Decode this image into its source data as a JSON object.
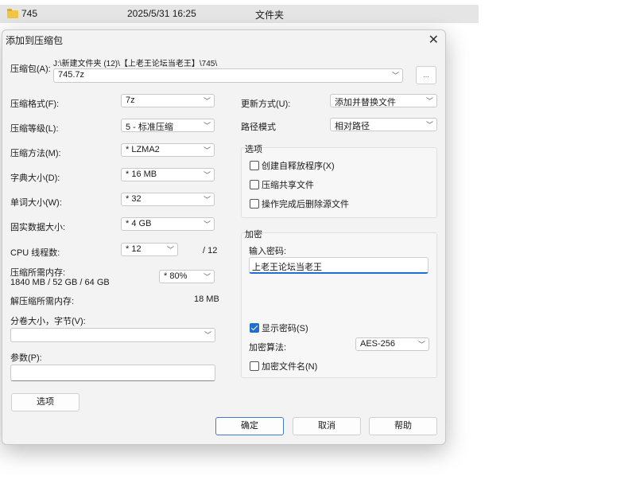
{
  "file_row": {
    "name": "745",
    "date": "2025/5/31 16:25",
    "type": "文件夹"
  },
  "dialog": {
    "title": "添加到压缩包",
    "archive_label": "压缩包(A):",
    "archive_path": "J:\\新建文件夹 (12)\\【上老王论坛当老王】\\745\\",
    "archive_name": "745.7z",
    "browse_label": "...",
    "format_label": "压缩格式(F):",
    "format_value": "7z",
    "level_label": "压缩等级(L):",
    "level_value": "5 - 标准压缩",
    "method_label": "压缩方法(M):",
    "method_value": "* LZMA2",
    "dict_label": "字典大小(D):",
    "dict_value": "* 16 MB",
    "word_label": "单词大小(W):",
    "word_value": "* 32",
    "solid_label": "固实数据大小:",
    "solid_value": "* 4 GB",
    "cpu_label": "CPU 线程数:",
    "cpu_value": "* 12",
    "cpu_max": "/ 12",
    "mem_label": "压缩所需内存:",
    "mem_detail": "1840 MB / 52 GB / 64 GB",
    "mem_value": "* 80%",
    "decomp_label": "解压缩所需内存:",
    "decomp_value": "18 MB",
    "volume_label": "分卷大小，字节(V):",
    "volume_value": "",
    "params_label": "参数(P):",
    "params_value": "",
    "options_button": "选项",
    "update_label": "更新方式(U):",
    "update_value": "添加并替换文件",
    "pathmode_label": "路径模式",
    "pathmode_value": "相对路径",
    "options_group": {
      "title": "选项",
      "items": [
        {
          "label": "创建自释放程序(X)",
          "checked": false
        },
        {
          "label": "压缩共享文件",
          "checked": false
        },
        {
          "label": "操作完成后删除源文件",
          "checked": false
        }
      ]
    },
    "encryption_group": {
      "title": "加密",
      "password_label": "输入密码:",
      "password_value": "上老王论坛当老王",
      "show_password": {
        "label": "显示密码(S)",
        "checked": true
      },
      "method_label": "加密算法:",
      "method_value": "AES-256",
      "encrypt_names": {
        "label": "加密文件名(N)",
        "checked": false
      }
    },
    "ok_button": "确定",
    "cancel_button": "取消",
    "help_button": "帮助"
  },
  "colors": {
    "accent": "#1f6fd1",
    "dialog_bg": "#f3f3f3",
    "folder": "#f3c545"
  }
}
